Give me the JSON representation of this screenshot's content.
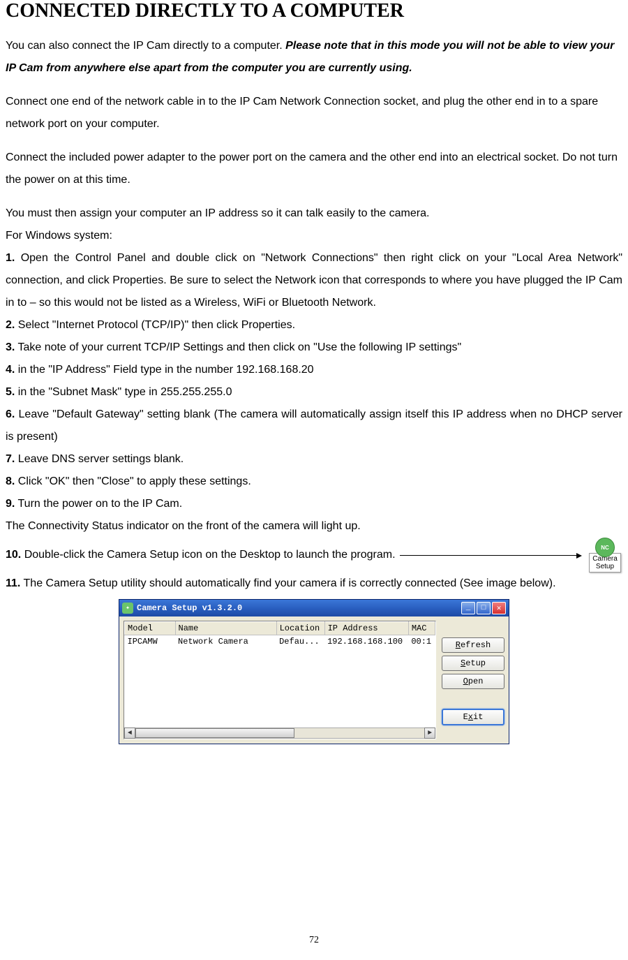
{
  "heading": "CONNECTED DIRECTLY TO A COMPUTER",
  "intro": {
    "lead": "You can also connect the IP Cam directly to a computer. ",
    "bold": "Please note that in this mode you will not be able to view your IP Cam from anywhere else apart from the computer you are currently using."
  },
  "para2": "Connect one end of the network cable in to the IP Cam Network Connection socket, and plug the other end in to a spare network port on your computer.",
  "para3": "Connect the included power adapter to the power port on the camera and the other end into an electrical socket. Do not turn the power on at this time.",
  "para4a": "You must then assign your computer an IP address so it can talk easily to the camera.",
  "para4b": "For Windows system:",
  "steps": {
    "s1": " Open the Control Panel and double click on \"Network Connections\" then right click on your \"Local Area Network\" connection, and click Properties. Be sure to select the Network icon that corresponds to where you have plugged the IP Cam in to – so this would not be listed as a Wireless, WiFi or Bluetooth Network.",
    "s2": " Select \"Internet Protocol (TCP/IP)\" then click Properties.",
    "s3": " Take note of your current TCP/IP Settings and then click on \"Use the following IP settings\"",
    "s4": " in the \"IP Address\" Field type in the number 192.168.168.20",
    "s5": " in the \"Subnet Mask\" type in 255.255.255.0",
    "s6": " Leave \"Default Gateway\" setting blank (The camera will automatically assign itself this IP address when no DHCP server is present)",
    "s7": " Leave DNS server settings blank.",
    "s8": " Click \"OK\" then \"Close\" to apply these settings.",
    "s9": " Turn the power on to the IP Cam.",
    "s9b": "The Connectivity Status indicator on the front of the camera will light up.",
    "s10": " Double-click the Camera Setup icon on the Desktop to launch the program.",
    "s11": " The Camera Setup utility should automatically find your camera if is correctly connected (See image below)."
  },
  "nums": {
    "n1": "1.",
    "n2": "2.",
    "n3": "3.",
    "n4": "4.",
    "n5": "5.",
    "n6": "6.",
    "n7": "7.",
    "n8": "8.",
    "n9": "9.",
    "n10": "10.",
    "n11": "11."
  },
  "desktop_icon": {
    "badge": "NC",
    "line1": "Camera",
    "line2": "Setup"
  },
  "app": {
    "title": "Camera Setup v1.3.2.0",
    "columns": {
      "model": "Model",
      "name": "Name",
      "location": "Location",
      "ip": "IP Address",
      "mac": "MAC"
    },
    "row": {
      "model": "IPCAMW",
      "name": "Network Camera",
      "location": "Defau...",
      "ip": "192.168.168.100",
      "mac": "00:1"
    },
    "buttons": {
      "refresh_u": "R",
      "refresh_rest": "efresh",
      "setup_u": "S",
      "setup_rest": "etup",
      "open_u": "O",
      "open_rest": "pen",
      "exit_u": "E",
      "exit_u2": "x",
      "exit_rest": "it"
    }
  },
  "page_number": "72"
}
